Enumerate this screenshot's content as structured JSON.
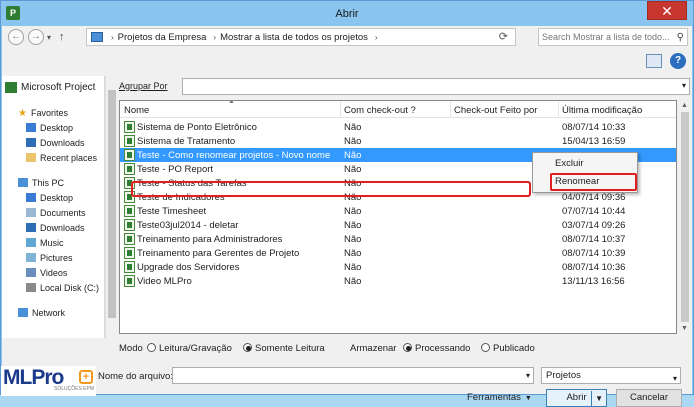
{
  "title": "Abrir",
  "address": {
    "crumbs": [
      "Projetos da Empresa",
      "Mostrar a lista de todos os projetos"
    ],
    "search_placeholder": "Search Mostrar a lista de todo..."
  },
  "left_pane": {
    "project": "Microsoft Project",
    "favorites_header": "Favorites",
    "favorites": [
      "Desktop",
      "Downloads",
      "Recent places"
    ],
    "pc_header": "This PC",
    "pc_items": [
      "Desktop",
      "Documents",
      "Downloads",
      "Music",
      "Pictures",
      "Videos",
      "Local Disk (C:)"
    ],
    "network": "Network"
  },
  "group_by_label": "Agrupar Por",
  "columns": [
    "Nome",
    "Com check-out ?",
    "Check-out Feito por",
    "Última modificação"
  ],
  "rows": [
    {
      "name": "Sistema de Ponto Eletrônico",
      "checkout": "Não",
      "modified": "08/07/14 10:33"
    },
    {
      "name": "Sistema de Tratamento",
      "checkout": "Não",
      "modified": "15/04/13 16:59"
    },
    {
      "name": "Teste - Como renomear projetos - Novo nome",
      "checkout": "Não",
      "modified": "",
      "selected": true
    },
    {
      "name": "Teste - PO Report",
      "checkout": "Não",
      "modified": ""
    },
    {
      "name": "Teste - Status das Tarefas",
      "checkout": "Não",
      "modified": ""
    },
    {
      "name": "Teste de Indicadores",
      "checkout": "Não",
      "modified": "04/07/14 09:36"
    },
    {
      "name": "Teste Timesheet",
      "checkout": "Não",
      "modified": "07/07/14 10:44"
    },
    {
      "name": "Teste03jul2014 - deletar",
      "checkout": "Não",
      "modified": "03/07/14 09:26"
    },
    {
      "name": "Treinamento para Administradores",
      "checkout": "Não",
      "modified": "08/07/14 10:37"
    },
    {
      "name": "Treinamento para Gerentes de Projeto",
      "checkout": "Não",
      "modified": "08/07/14 10:39"
    },
    {
      "name": "Upgrade dos Servidores",
      "checkout": "Não",
      "modified": "08/07/14 10:36"
    },
    {
      "name": "Video MLPro",
      "checkout": "Não",
      "modified": "13/11/13 16:56"
    }
  ],
  "context_menu": [
    "Excluir",
    "Renomear"
  ],
  "mode": {
    "label": "Modo",
    "option1": "Leitura/Gravação",
    "option2": "Somente Leitura",
    "store_label": "Armazenar",
    "option3": "Processando",
    "option4": "Publicado"
  },
  "filename_label": "Nome do arquivo:",
  "filetype": "Projetos",
  "tools_label": "Ferramentas",
  "open_label": "Abrir",
  "cancel_label": "Cancelar",
  "logo": {
    "ml": "ML",
    "pro": "Pro",
    "sub": "SOLUÇÕES EPM"
  }
}
